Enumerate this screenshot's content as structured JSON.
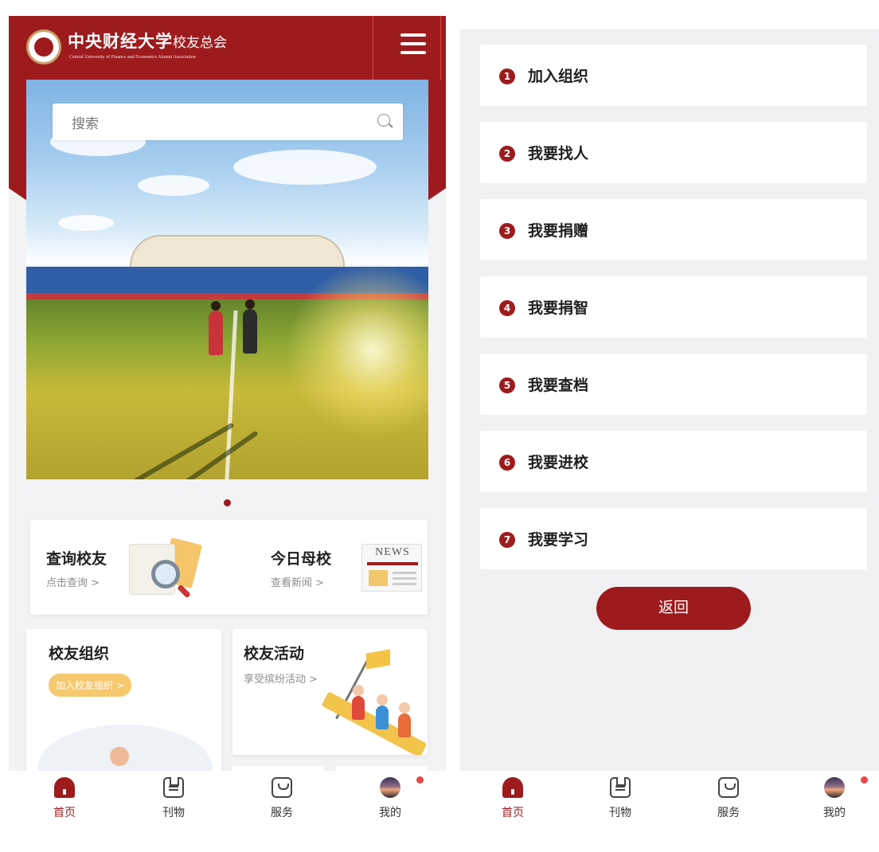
{
  "header": {
    "brand_cn": "中央财经大学",
    "brand_sub": "校友总会",
    "brand_en": "Central University of Finance and Economics Alumni Association"
  },
  "search": {
    "placeholder": "搜索"
  },
  "cards": {
    "query_alumni": {
      "title": "查询校友",
      "sub": "点击查询 >"
    },
    "today_school": {
      "title": "今日母校",
      "sub": "查看新闻 >",
      "news_badge": "NEWS"
    },
    "org": {
      "title": "校友组织",
      "pill": "加入校友组织 >"
    },
    "activity": {
      "title": "校友活动",
      "sub": "享受缤纷活动 >"
    }
  },
  "menu": {
    "items": [
      {
        "num": "1",
        "label": "加入组织"
      },
      {
        "num": "2",
        "label": "我要找人"
      },
      {
        "num": "3",
        "label": "我要捐赠"
      },
      {
        "num": "4",
        "label": "我要捐智"
      },
      {
        "num": "5",
        "label": "我要查档"
      },
      {
        "num": "6",
        "label": "我要进校"
      },
      {
        "num": "7",
        "label": "我要学习"
      }
    ],
    "back_label": "返回"
  },
  "tabbar": {
    "home": "首页",
    "publication": "刊物",
    "service": "服务",
    "mine": "我的"
  },
  "colors": {
    "brand_red": "#9e1b1d",
    "accent_yellow": "#f6c96e",
    "badge_red": "#ee4646"
  }
}
